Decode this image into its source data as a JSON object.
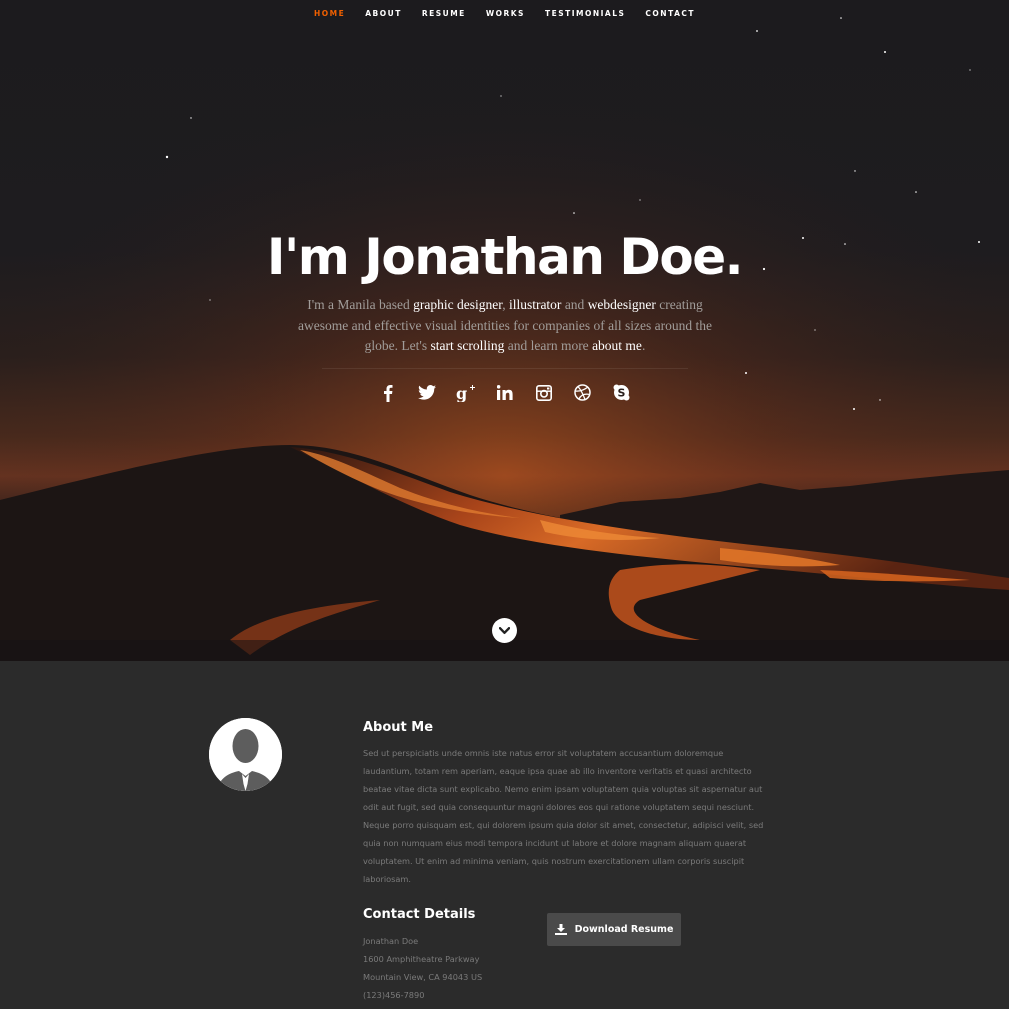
{
  "nav": {
    "items": [
      {
        "label": "HOME",
        "active": true
      },
      {
        "label": "ABOUT"
      },
      {
        "label": "RESUME"
      },
      {
        "label": "WORKS"
      },
      {
        "label": "TESTIMONIALS"
      },
      {
        "label": "CONTACT"
      }
    ],
    "active_color": "#f06000"
  },
  "hero": {
    "title": "I'm Jonathan Doe.",
    "desc": {
      "t1": "I'm a Manila based ",
      "h1": "graphic designer",
      "t2": ", ",
      "h2": "illustrator",
      "t3": " and ",
      "h3": "webdesigner",
      "t4": " creating awesome and effective visual identities for companies of all sizes around the globe. Let's ",
      "h4": "start scrolling",
      "t5": " and learn more ",
      "h5": "about me",
      "t6": "."
    },
    "social_icons": [
      "facebook-icon",
      "twitter-icon",
      "google-plus-icon",
      "linkedin-icon",
      "instagram-icon",
      "dribbble-icon",
      "skype-icon"
    ],
    "scroll_icon": "chevron-down-icon"
  },
  "about": {
    "title": "About Me",
    "text": "Sed ut perspiciatis unde omnis iste natus error sit voluptatem accusantium doloremque laudantium, totam rem aperiam, eaque ipsa quae ab illo inventore veritatis et quasi architecto beatae vitae dicta sunt explicabo. Nemo enim ipsam voluptatem quia voluptas sit aspernatur aut odit aut fugit, sed quia consequuntur magni dolores eos qui ratione voluptatem sequi nesciunt. Neque porro quisquam est, qui dolorem ipsum quia dolor sit amet, consectetur, adipisci velit, sed quia non numquam eius modi tempora incidunt ut labore et dolore magnam aliquam quaerat voluptatem. Ut enim ad minima veniam, quis nostrum exercitationem ullam corporis suscipit laboriosam.",
    "avatar_icon": "user-avatar-icon"
  },
  "contact": {
    "title": "Contact Details",
    "lines": [
      "Jonathan Doe",
      "1600 Amphitheatre Parkway",
      "Mountain View, CA 94043 US",
      "(123)456-7890"
    ]
  },
  "download": {
    "label": "Download Resume",
    "icon": "download-icon"
  },
  "colors": {
    "accent": "#f06000",
    "about_bg": "#2b2b2b",
    "button_bg": "#4a4a4a"
  }
}
